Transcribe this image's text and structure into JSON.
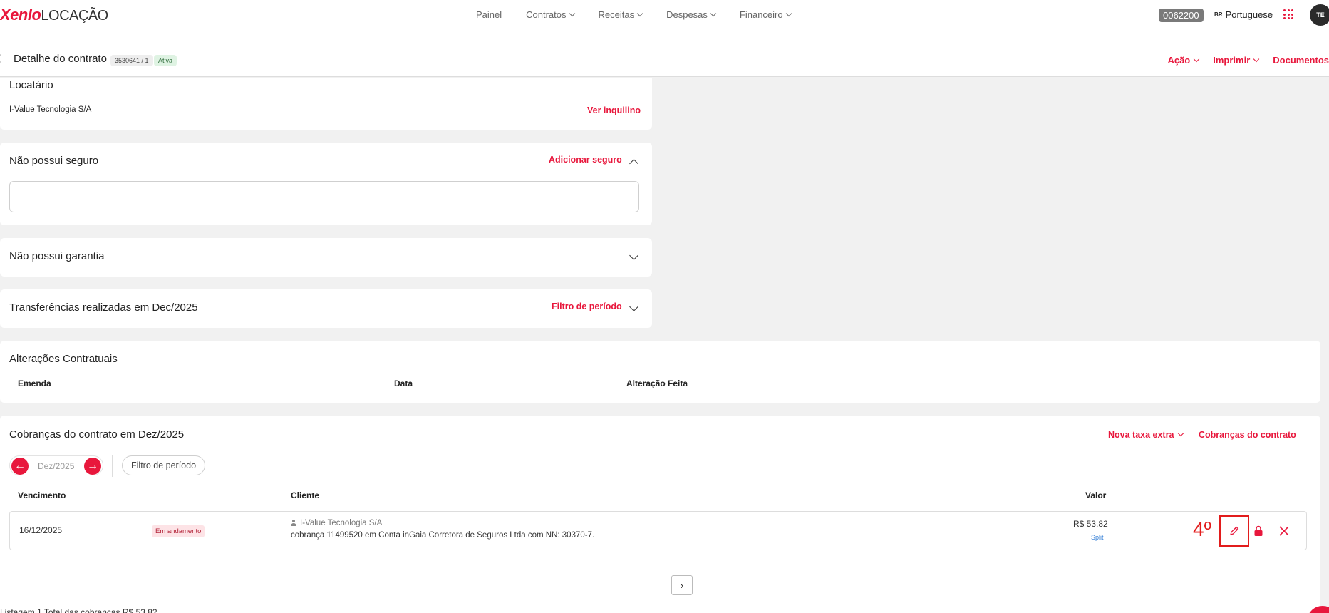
{
  "app": {
    "brand": "Xenlo",
    "product": "LOCAÇÃO"
  },
  "nav": [
    {
      "label": "Painel",
      "has_menu": false
    },
    {
      "label": "Contratos",
      "has_menu": true
    },
    {
      "label": "Receitas",
      "has_menu": true
    },
    {
      "label": "Despesas",
      "has_menu": true
    },
    {
      "label": "Financeiro",
      "has_menu": true
    }
  ],
  "account": {
    "code": "0062200",
    "lang_flag": "BR",
    "language": "Portuguese",
    "avatar_initials": "TE"
  },
  "subheader": {
    "title": "Detalhe do contrato",
    "contract_id": "3530641 / 1",
    "status": "Ativa",
    "actions": [
      "Ação",
      "Imprimir",
      "Documentos"
    ]
  },
  "tenant": {
    "title": "Locatário",
    "name": "I-Value Tecnologia S/A",
    "link": "Ver inquilino"
  },
  "insurance": {
    "title": "Não possui seguro",
    "link": "Adicionar seguro"
  },
  "guarantee": {
    "title": "Não possui garantia"
  },
  "transfers": {
    "title": "Transferências realizadas em Dec/2025",
    "link": "Filtro de período"
  },
  "amendments": {
    "title": "Alterações Contratuais",
    "columns": [
      "Emenda",
      "Data",
      "Alteração Feita"
    ]
  },
  "charges": {
    "title": "Cobranças do contrato em Dez/2025",
    "new_fee": "Nova taxa extra",
    "all_charges": "Cobranças do contrato",
    "period": "Dez/2025",
    "period_filter": "Filtro de período",
    "columns": {
      "due": "Vencimento",
      "client": "Cliente",
      "amount": "Valor"
    },
    "rows": [
      {
        "due": "16/12/2025",
        "status": "Em andamento",
        "client": "I-Value Tecnologia S/A",
        "description": "cobrança 11499520 em Conta inGaia Corretora de Seguros Ltda com NN: 30370-7.",
        "amount": "R$ 53,82",
        "split": "Split"
      }
    ],
    "footer": "Listagem 1 Total das cobranças R$ 53,82"
  },
  "annotation": {
    "step": "4º"
  },
  "colors": {
    "accent": "#e8173c",
    "highlight": "#e21c1c"
  },
  "icons": [
    "menu-chevron-icon",
    "apps-grid-icon",
    "back-arrow-icon",
    "chevron-up-icon",
    "chevron-down-icon",
    "arrow-left-icon",
    "arrow-right-icon",
    "person-icon",
    "pencil-icon",
    "lock-icon",
    "close-icon",
    "chevron-right-icon"
  ]
}
